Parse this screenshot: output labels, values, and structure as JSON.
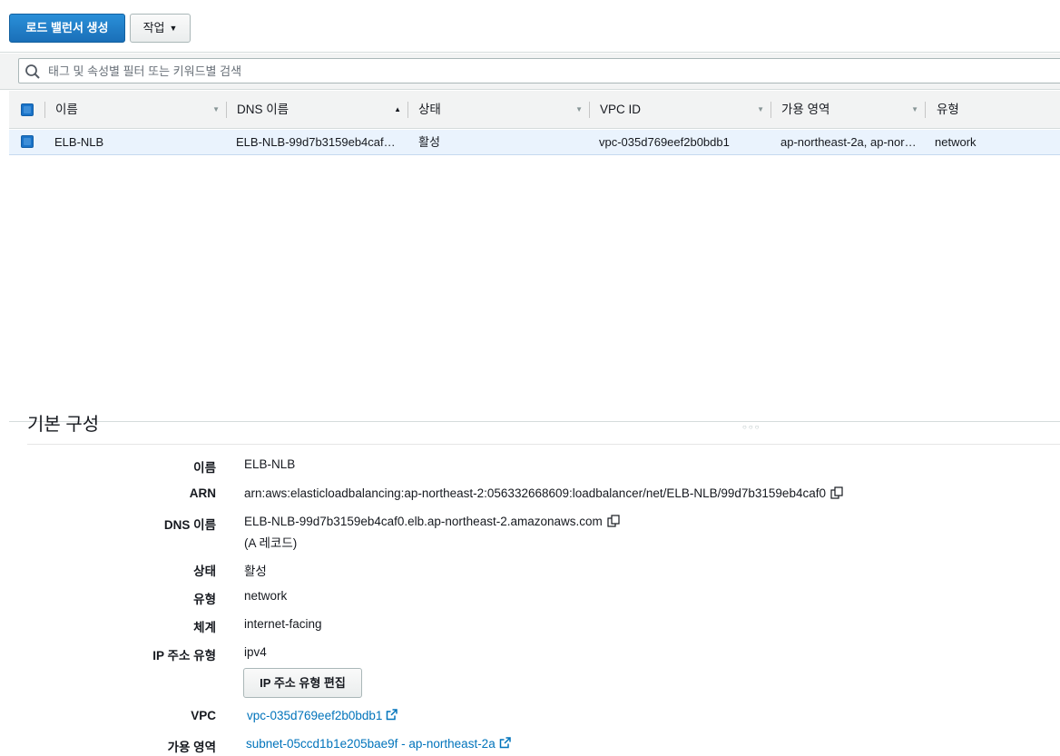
{
  "toolbar": {
    "create_button": "로드 밸런서 생성",
    "actions_button": "작업"
  },
  "search": {
    "placeholder": "태그 및 속성별 필터 또는 키워드별 검색"
  },
  "table": {
    "columns": [
      "이름",
      "DNS 이름",
      "상태",
      "VPC ID",
      "가용 영역",
      "유형"
    ],
    "rows": [
      {
        "name": "ELB-NLB",
        "dns": "ELB-NLB-99d7b3159eb4caf…",
        "state": "활성",
        "vpc_id": "vpc-035d769eef2b0bdb1",
        "az": "ap-northeast-2a, ap-nor…",
        "type": "network"
      }
    ]
  },
  "details": {
    "section_title": "기본 구성",
    "name_label": "이름",
    "name_value": "ELB-NLB",
    "arn_label": "ARN",
    "arn_value": "arn:aws:elasticloadbalancing:ap-northeast-2:056332668609:loadbalancer/net/ELB-NLB/99d7b3159eb4caf0",
    "dns_label": "DNS 이름",
    "dns_value": "ELB-NLB-99d7b3159eb4caf0.elb.ap-northeast-2.amazonaws.com",
    "dns_note": "(A 레코드)",
    "state_label": "상태",
    "state_value": "활성",
    "type_label": "유형",
    "type_value": "network",
    "scheme_label": "체계",
    "scheme_value": "internet-facing",
    "ip_type_label": "IP 주소 유형",
    "ip_type_value": "ipv4",
    "edit_ip_button": "IP 주소 유형 편집",
    "vpc_label": "VPC",
    "vpc_value": "vpc-035d769eef2b0bdb1",
    "az_label": "가용 영역",
    "az_value": "subnet-05ccd1b1e205bae9f - ap-northeast-2a"
  },
  "colors": {
    "primary": "#1a6fb8",
    "link": "#0073bb",
    "selected_row": "#eaf3fd",
    "header_bg": "#f2f3f3"
  }
}
